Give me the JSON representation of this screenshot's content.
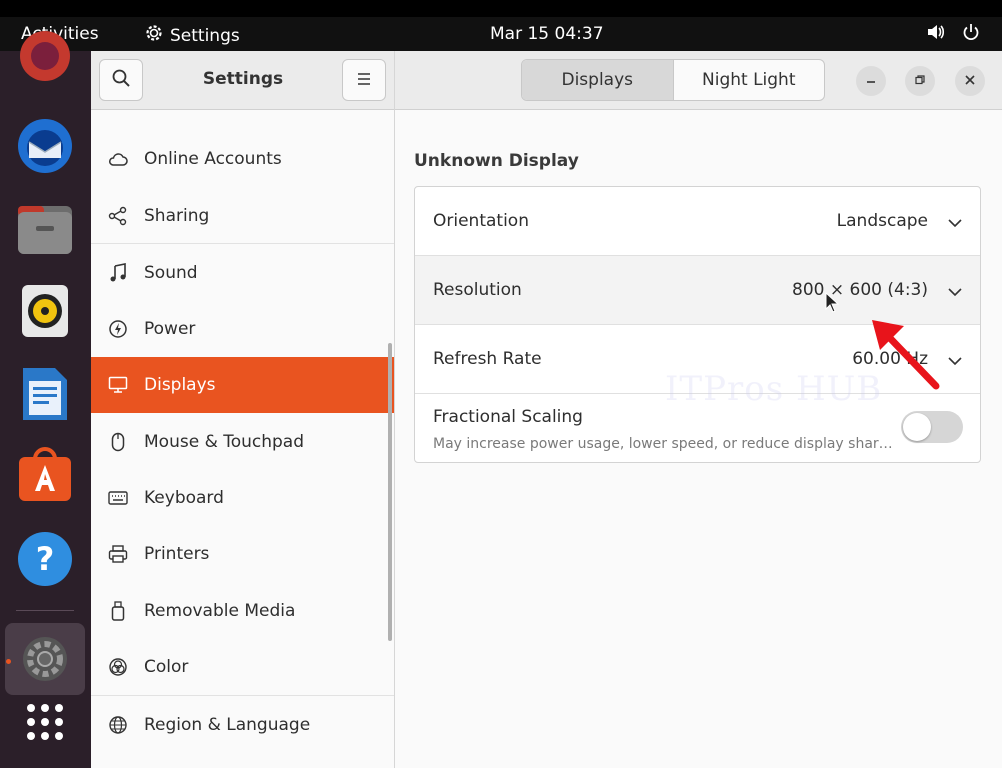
{
  "panel": {
    "activities": "Activities",
    "app_name": "Settings",
    "clock": "Mar 15  04:37"
  },
  "sidebar": {
    "title": "Settings",
    "items": [
      {
        "label": "Online Accounts",
        "icon": "cloud-icon"
      },
      {
        "label": "Sharing",
        "icon": "share-icon"
      },
      {
        "label": "Sound",
        "icon": "music-note-icon"
      },
      {
        "label": "Power",
        "icon": "power-icon"
      },
      {
        "label": "Displays",
        "icon": "display-icon",
        "active": true
      },
      {
        "label": "Mouse & Touchpad",
        "icon": "mouse-icon"
      },
      {
        "label": "Keyboard",
        "icon": "keyboard-icon"
      },
      {
        "label": "Printers",
        "icon": "printer-icon"
      },
      {
        "label": "Removable Media",
        "icon": "usb-drive-icon"
      },
      {
        "label": "Color",
        "icon": "color-icon"
      },
      {
        "label": "Region & Language",
        "icon": "globe-icon"
      }
    ]
  },
  "tabs": [
    {
      "label": "Displays",
      "active": true
    },
    {
      "label": "Night Light",
      "active": false
    }
  ],
  "content": {
    "section_title": "Unknown Display",
    "rows": {
      "orientation": {
        "label": "Orientation",
        "value": "Landscape"
      },
      "resolution": {
        "label": "Resolution",
        "value": "800 × 600 (4:3)"
      },
      "refresh_rate": {
        "label": "Refresh Rate",
        "value": "60.00 Hz"
      },
      "fractional_scaling": {
        "label": "Fractional Scaling",
        "description": "May increase power usage, lower speed, or reduce display shar…",
        "enabled": false
      }
    }
  },
  "watermark": "ITPros HUB",
  "colors": {
    "accent": "#e95420",
    "dock_bg": "#2b1f29",
    "annotation_arrow": "#e8141b"
  }
}
